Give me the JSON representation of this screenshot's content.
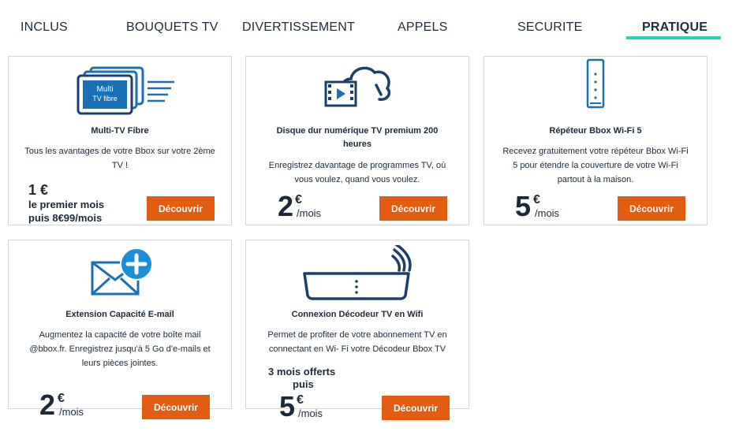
{
  "tabs": [
    {
      "label": "INCLUS"
    },
    {
      "label": "BOUQUETS TV"
    },
    {
      "label": "DIVERTISSEMENT"
    },
    {
      "label": "APPELS"
    },
    {
      "label": "SECURITE"
    },
    {
      "label": "PRATIQUE",
      "active": true
    }
  ],
  "colors": {
    "accent": "#2bd3b5",
    "button": "#e25d12",
    "icon": "#1a6fb5",
    "text": "#1b2a3a"
  },
  "cards": [
    {
      "icon": "multi-tv-icon",
      "icon_text_1": "Multi",
      "icon_text_2": "TV fibre",
      "title": "Multi-TV Fibre",
      "desc_1": "Tous les avantages de votre Bbox sur votre 2ème",
      "desc_2": "TV !",
      "price_amount": "1 €",
      "price_line_1": "le premier mois",
      "price_line_2": "puis 8€99/mois",
      "button": "Découvrir"
    },
    {
      "icon": "cloud-film-icon",
      "title_1": "Disque dur numérique TV premium 200",
      "title_2": "heures",
      "desc_1": "Enregistrez davantage de programmes TV, où",
      "desc_2": "vous voulez, quand vous voulez.",
      "price_amount": "2",
      "price_currency": "€",
      "price_period": "/mois",
      "button": "Découvrir"
    },
    {
      "icon": "wifi-repeater-icon",
      "title": "Répéteur Bbox Wi-Fi 5",
      "desc_1": "Recevez gratuitement votre répéteur Bbox Wi-Fi",
      "desc_2": "5 pour étendre la couverture de votre Wi-Fi",
      "desc_3": "partout à la maison.",
      "price_amount": "5",
      "price_currency": "€",
      "price_period": "/mois",
      "button": "Découvrir"
    },
    {
      "icon": "email-add-icon",
      "title": "Extension Capacité E-mail",
      "desc_1": "Augmentez la capacité de votre boîte mail",
      "desc_2": "@bbox.fr. Enregistrez jusqu'à 5 Go d'e-mails et",
      "desc_3": "leurs pièces jointes.",
      "price_amount": "2",
      "price_currency": "€",
      "price_period": "/mois",
      "button": "Découvrir"
    },
    {
      "icon": "wifi-decoder-icon",
      "title": "Connexion Décodeur TV en Wifi",
      "desc_1": "Permet de profiter de votre abonnement TV en",
      "desc_2": "connectant en Wi- Fi votre Décodeur Bbox TV",
      "promo_1": "3 mois offerts",
      "promo_2": "puis",
      "price_amount": "5",
      "price_currency": "€",
      "price_period": "/mois",
      "button": "Découvrir"
    }
  ]
}
